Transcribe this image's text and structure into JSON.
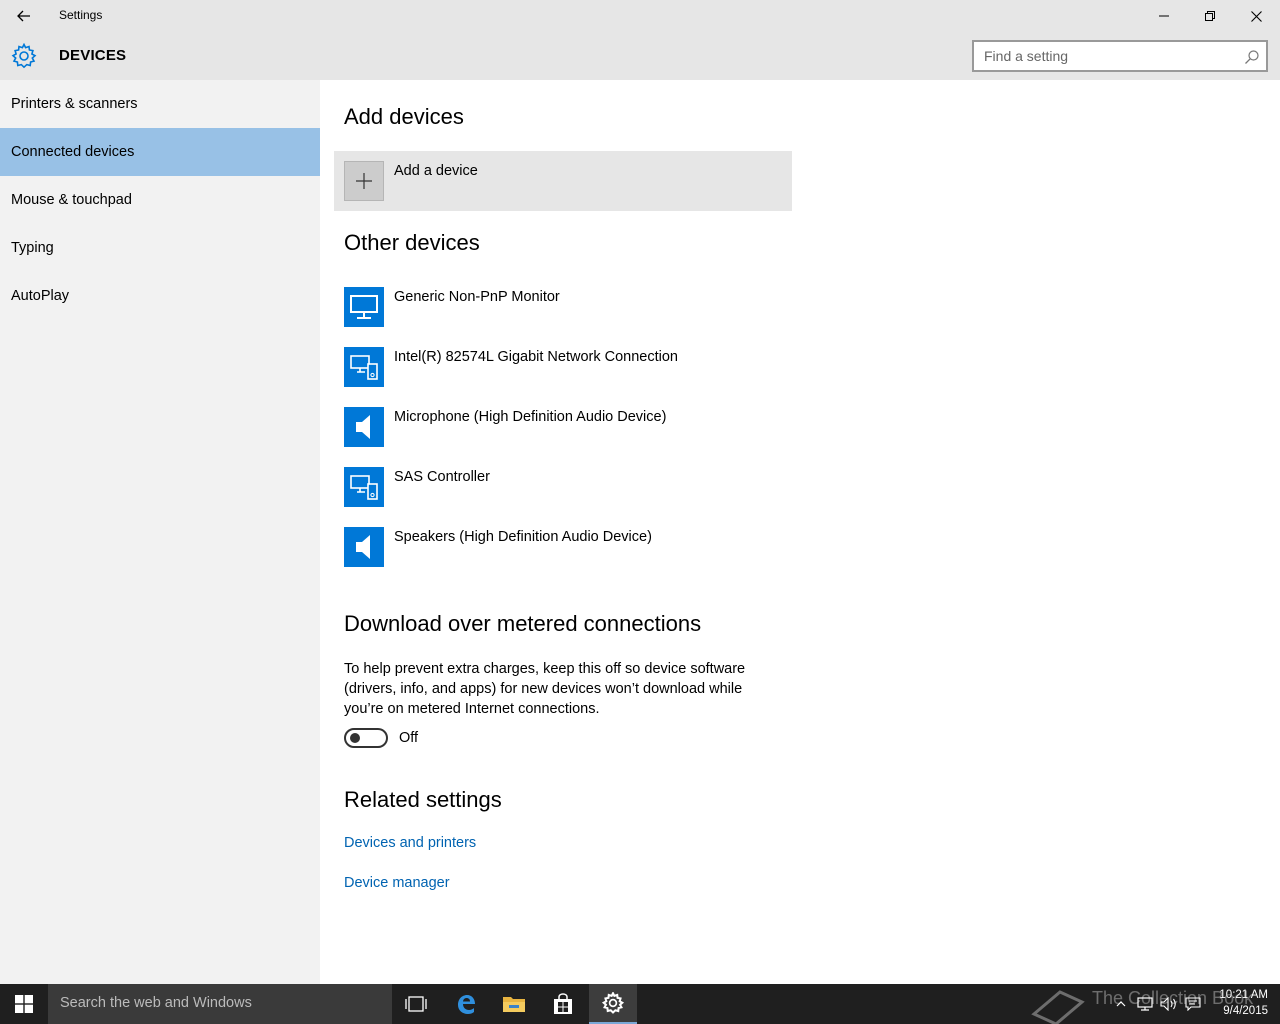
{
  "window": {
    "title": "Settings"
  },
  "header": {
    "section_title": "DEVICES",
    "search_placeholder": "Find a setting"
  },
  "sidebar": {
    "items": [
      {
        "label": "Printers & scanners"
      },
      {
        "label": "Connected devices",
        "selected": true
      },
      {
        "label": "Mouse & touchpad"
      },
      {
        "label": "Typing"
      },
      {
        "label": "AutoPlay"
      }
    ]
  },
  "main": {
    "add_devices_heading": "Add devices",
    "add_device_label": "Add a device",
    "other_devices_heading": "Other devices",
    "devices": [
      {
        "name": "Generic Non-PnP Monitor",
        "icon": "monitor-icon"
      },
      {
        "name": "Intel(R) 82574L Gigabit Network Connection",
        "icon": "generic-device-icon"
      },
      {
        "name": "Microphone (High Definition Audio Device)",
        "icon": "speaker-icon"
      },
      {
        "name": "SAS Controller",
        "icon": "generic-device-icon"
      },
      {
        "name": "Speakers (High Definition Audio Device)",
        "icon": "speaker-icon"
      }
    ],
    "metered_heading": "Download over metered connections",
    "metered_description": "To help prevent extra charges, keep this off so device software (drivers, info, and apps) for new devices won’t download while you’re on metered Internet connections.",
    "metered_toggle_state": "Off",
    "related_heading": "Related settings",
    "related_links": [
      {
        "label": "Devices and printers"
      },
      {
        "label": "Device manager"
      }
    ]
  },
  "taskbar": {
    "search_placeholder": "Search the web and Windows",
    "time": "10:21 AM",
    "date": "9/4/2015",
    "watermark": "The Collection Book"
  },
  "colors": {
    "accent": "#0078d7",
    "selected_nav": "#98c1e6",
    "link": "#0063b1",
    "chrome": "#e6e6e6",
    "taskbar": "#1f1f1f"
  }
}
